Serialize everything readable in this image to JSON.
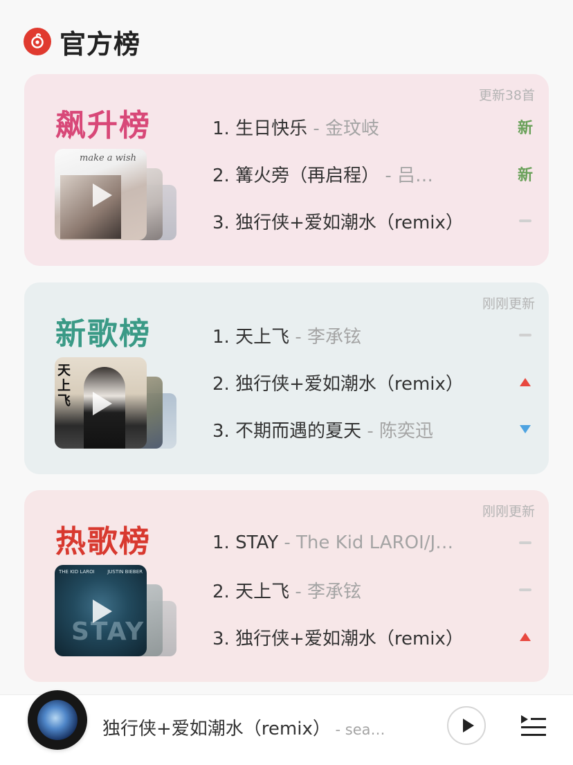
{
  "header": {
    "title": "官方榜",
    "logo_icon": "netease-music-icon",
    "accent": "#e03a2f"
  },
  "charts": [
    {
      "name": "飙升榜",
      "color": "#d84878",
      "update": "更新38首",
      "tracks": [
        {
          "rank": "1.",
          "song": "生日快乐",
          "artist": " - 金玟岐",
          "status": "新"
        },
        {
          "rank": "2.",
          "song": "篝火旁（再启程）",
          "artist": " - 吕…",
          "status": "新"
        },
        {
          "rank": "3.",
          "song": "独行侠+爱如潮水（remix）",
          "artist": "",
          "status": "same"
        }
      ],
      "cover_text": "make a wish"
    },
    {
      "name": "新歌榜",
      "color": "#3a9a86",
      "update": "刚刚更新",
      "tracks": [
        {
          "rank": "1.",
          "song": "天上飞",
          "artist": " - 李承铉",
          "status": "same"
        },
        {
          "rank": "2.",
          "song": "独行侠+爱如潮水（remix）",
          "artist": "",
          "status": "up"
        },
        {
          "rank": "3.",
          "song": "不期而遇的夏天",
          "artist": " - 陈奕迅",
          "status": "down"
        }
      ],
      "cover_text": "天上飞"
    },
    {
      "name": "热歌榜",
      "color": "#d8392f",
      "update": "刚刚更新",
      "tracks": [
        {
          "rank": "1.",
          "song": "STAY",
          "artist": " - The Kid LAROI/J…",
          "status": "same"
        },
        {
          "rank": "2.",
          "song": "天上飞",
          "artist": " - 李承铉",
          "status": "same"
        },
        {
          "rank": "3.",
          "song": "独行侠+爱如潮水（remix）",
          "artist": "",
          "status": "up"
        }
      ],
      "cover_text": "STAY"
    }
  ],
  "player": {
    "song": "独行侠+爱如潮水（remix）",
    "artist": " - sea…",
    "play_icon": "play-icon",
    "playlist_icon": "playlist-icon"
  }
}
